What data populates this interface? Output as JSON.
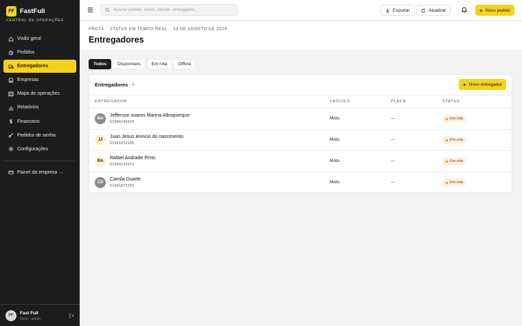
{
  "brand": {
    "logo": "FF",
    "name": "FastFull",
    "subtitle": "CENTRAL DE OPERAÇÕES",
    "accent": "#f5d21c"
  },
  "sidebar": {
    "items": [
      {
        "label": "Visão geral",
        "icon": "home-icon"
      },
      {
        "label": "Pedidos",
        "icon": "box-icon"
      },
      {
        "label": "Entregadores",
        "icon": "truck-icon",
        "active": true
      },
      {
        "label": "Empresas",
        "icon": "store-icon"
      },
      {
        "label": "Mapa de operações",
        "icon": "map-icon"
      },
      {
        "label": "Relatórios",
        "icon": "bar-chart-icon"
      },
      {
        "label": "Financeiro",
        "icon": "dollar-icon"
      },
      {
        "label": "Pedidos de senha",
        "icon": "key-icon"
      },
      {
        "label": "Configurações",
        "icon": "gear-icon"
      }
    ],
    "company_link": "Painel da empresa →",
    "user": {
      "initials": "FF",
      "name": "Fast Full",
      "role": "Dono · admin"
    }
  },
  "topbar": {
    "search_placeholder": "Buscar pedido, ticket, cliente, entregador...",
    "export_label": "Exportar",
    "refresh_label": "Atualizar",
    "new_order_label": "Novo pedido"
  },
  "header": {
    "breadcrumb": [
      "FROTA",
      "STATUS EM TEMPO REAL",
      "14 DE AGOSTO DE 2026"
    ],
    "title": "Entregadores"
  },
  "tabs": [
    {
      "label": "Todos",
      "active": true
    },
    {
      "label": "Disponíveis"
    },
    {
      "label": "Em rota"
    },
    {
      "label": "Offline"
    }
  ],
  "card": {
    "title": "Entregadores",
    "count": "· 4",
    "new_button": "Novo entregador",
    "columns": [
      "ENTREGADOR",
      "VEÍCULO",
      "PLACA",
      "STATUS"
    ],
    "rows": [
      {
        "initials": "MA",
        "name": "Jefferson soares Marina Albuquerque",
        "phone": "61984249450",
        "vehicle": "Moto",
        "plate": "—",
        "status": "Em rota",
        "avatar_bg": "#8a8a8f",
        "avatar_fg": "#ffffff"
      },
      {
        "initials": "JJ",
        "name": "Juan Jesus leoncio do nascimento",
        "phone": "61981932106",
        "vehicle": "Moto",
        "plate": "—",
        "status": "Em rota",
        "avatar_bg": "#fdf3c4",
        "avatar_fg": "#1c1c1e"
      },
      {
        "initials": "RA",
        "name": "Rafael Andrade Pinto",
        "phone": "61999243072",
        "vehicle": "Moto",
        "plate": "—",
        "status": "Em rota",
        "avatar_bg": "#fdf3c4",
        "avatar_fg": "#1c1c1e"
      },
      {
        "initials": "CD",
        "name": "Camila Duarte",
        "phone": "61981875303",
        "vehicle": "Moto",
        "plate": "—",
        "status": "Em rota",
        "avatar_bg": "#8a8a8f",
        "avatar_fg": "#ffffff"
      }
    ]
  }
}
